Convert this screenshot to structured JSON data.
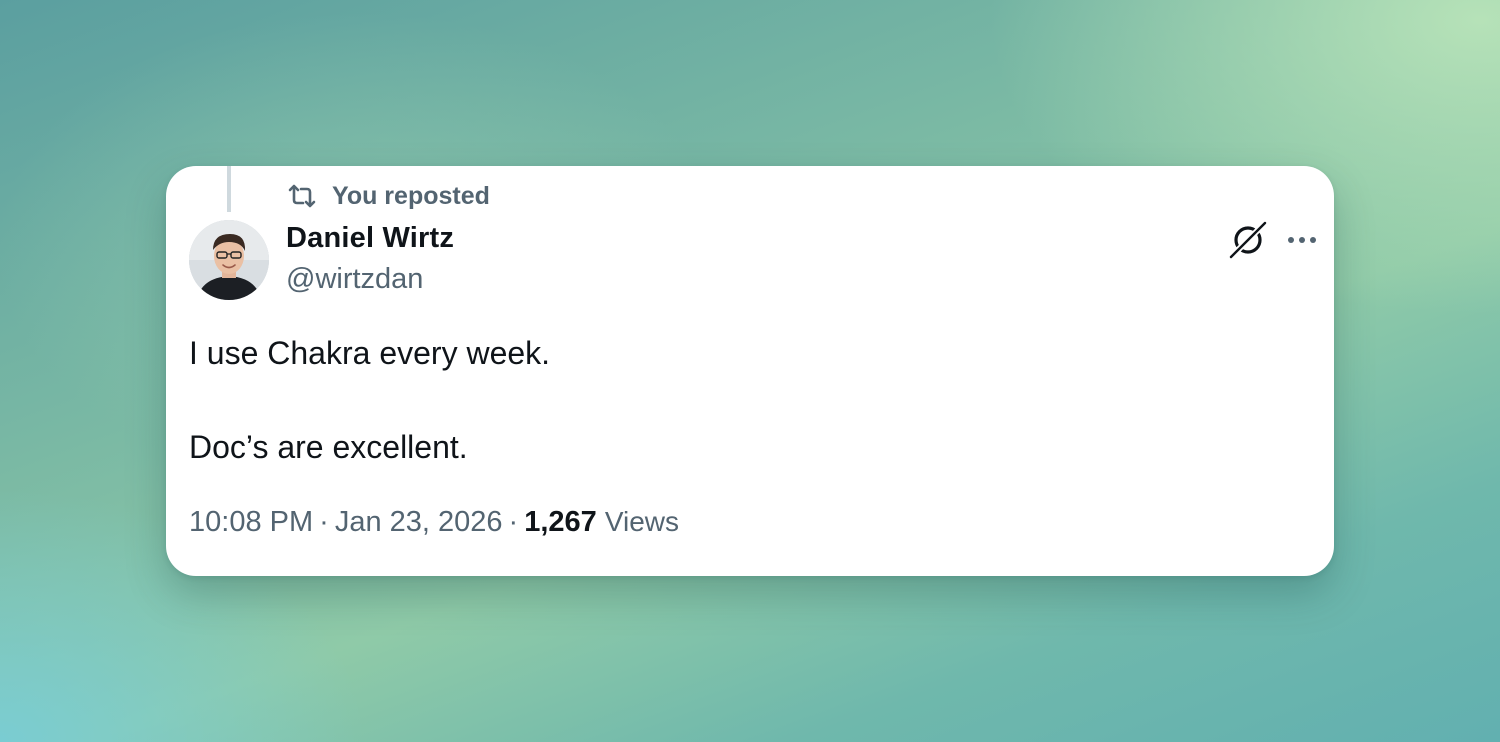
{
  "tweet": {
    "repost_label": "You reposted",
    "author_name": "Daniel Wirtz",
    "author_handle": "@wirtzdan",
    "text_line_1": "I use Chakra every week.",
    "text_line_2": "Doc’s are excellent.",
    "time": "10:08 PM",
    "separator": "·",
    "date": "Jan 23, 2026",
    "views_count": "1,267",
    "views_label": "Views"
  },
  "icons": {
    "repost": "repost-icon",
    "grok": "grok-icon",
    "more": "more-icon"
  },
  "colors": {
    "text_primary": "#0f1419",
    "text_secondary": "#536471",
    "card_background": "#ffffff"
  }
}
